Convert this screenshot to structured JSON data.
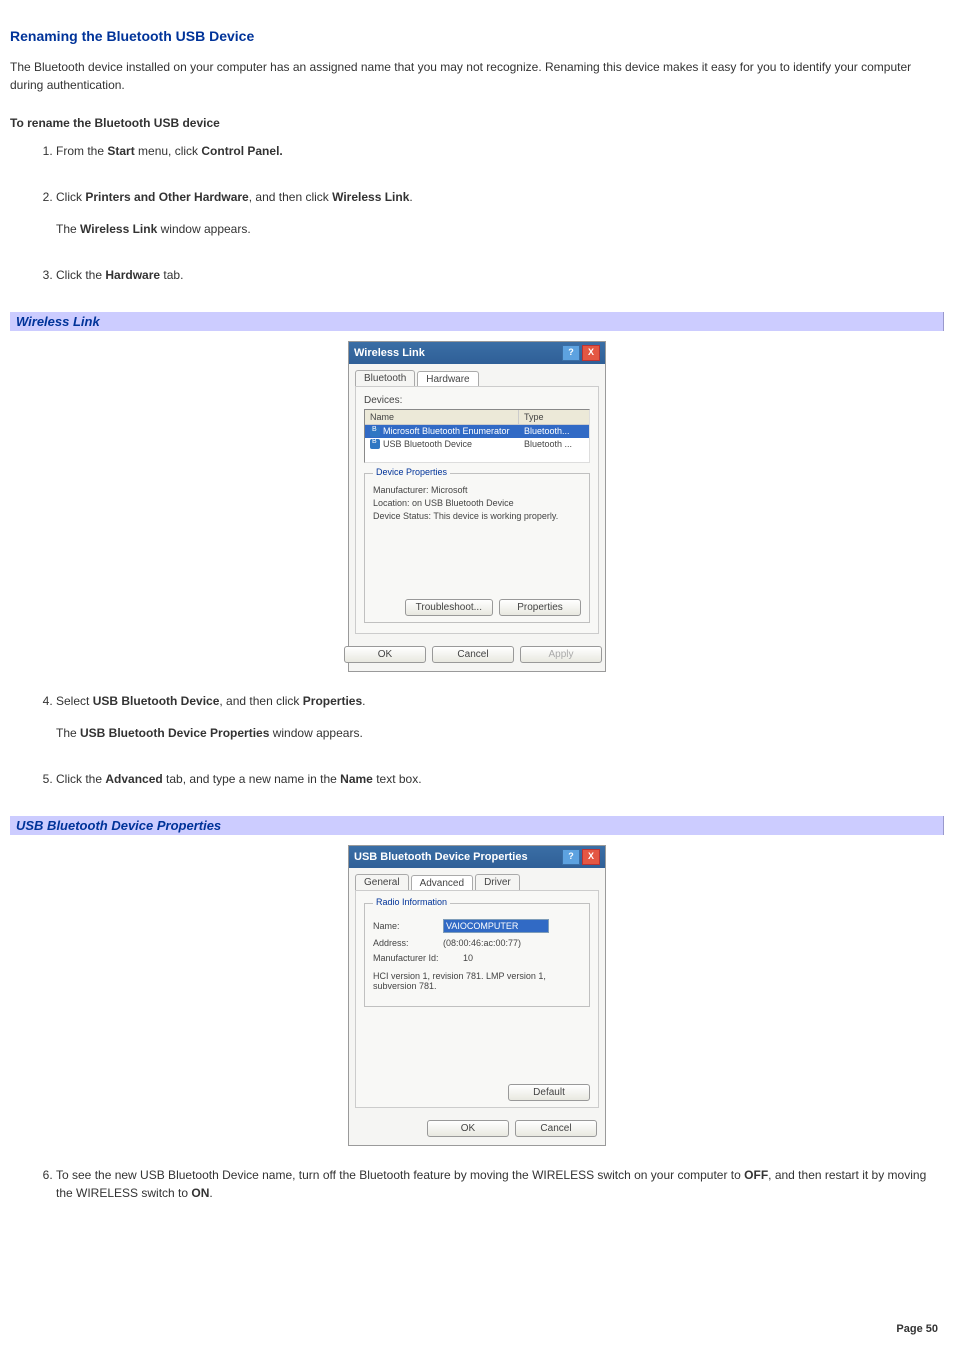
{
  "heading": "Renaming the Bluetooth USB Device",
  "intro": "The Bluetooth    device installed on your computer has an assigned name that you may not recognize. Renaming this device makes it easy for you to identify your computer during authentication.",
  "subhead": "To rename the Bluetooth USB device",
  "steps": {
    "s1a": "From the ",
    "s1b": "Start",
    "s1c": " menu, click ",
    "s1d": "Control Panel.",
    "s2a": "Click ",
    "s2b": "Printers and Other Hardware",
    "s2c": ", and then click ",
    "s2d": "Wireless Link",
    "s2e": ".",
    "s2fa": "The ",
    "s2fb": "Wireless Link",
    "s2fc": " window appears.",
    "s3a": "Click the ",
    "s3b": "Hardware",
    "s3c": " tab.",
    "s4a": "Select ",
    "s4b": "USB Bluetooth Device",
    "s4c": ", and then click ",
    "s4d": "Properties",
    "s4e": ".",
    "s4fa": "The ",
    "s4fb": "USB Bluetooth Device Properties",
    "s4fc": " window appears.",
    "s5a": "Click the ",
    "s5b": "Advanced",
    "s5c": " tab, and type a new name in the ",
    "s5d": "Name",
    "s5e": " text box.",
    "s6a": "To see the new USB Bluetooth Device name, turn off the Bluetooth feature by moving the WIRELESS switch on your computer to ",
    "s6b": "OFF",
    "s6c": ", and then restart it by moving the WIRELESS switch to ",
    "s6d": "ON",
    "s6e": "."
  },
  "captions": {
    "wireless": "Wireless Link",
    "props": "USB Bluetooth Device Properties"
  },
  "dialog1": {
    "title": "Wireless Link",
    "tabs": {
      "t0": "Bluetooth",
      "t1": "Hardware"
    },
    "devicesLabel": "Devices:",
    "headers": {
      "name": "Name",
      "type": "Type"
    },
    "rows": [
      {
        "name": "Microsoft Bluetooth Enumerator",
        "type": "Bluetooth..."
      },
      {
        "name": "USB Bluetooth Device",
        "type": "Bluetooth ..."
      }
    ],
    "group": {
      "legend": "Device Properties",
      "l1": "Manufacturer: Microsoft",
      "l2": "Location: on USB Bluetooth Device",
      "l3": "Device Status: This device is working properly."
    },
    "btns": {
      "trouble": "Troubleshoot...",
      "props": "Properties",
      "ok": "OK",
      "cancel": "Cancel",
      "apply": "Apply"
    }
  },
  "dialog2": {
    "title": "USB Bluetooth Device Properties",
    "tabs": {
      "t0": "General",
      "t1": "Advanced",
      "t2": "Driver"
    },
    "group": {
      "legend": "Radio Information",
      "nameLabel": "Name:",
      "nameValue": "VAIOCOMPUTER",
      "addrLabel": "Address:",
      "addrValue": "(08:00:46:ac:00:77)",
      "manuLabel": "Manufacturer Id:",
      "manuValue": "10",
      "hci": "HCI version 1, revision 781.  LMP version 1, subversion 781."
    },
    "btns": {
      "default": "Default",
      "ok": "OK",
      "cancel": "Cancel"
    }
  },
  "footer": "Page 50"
}
